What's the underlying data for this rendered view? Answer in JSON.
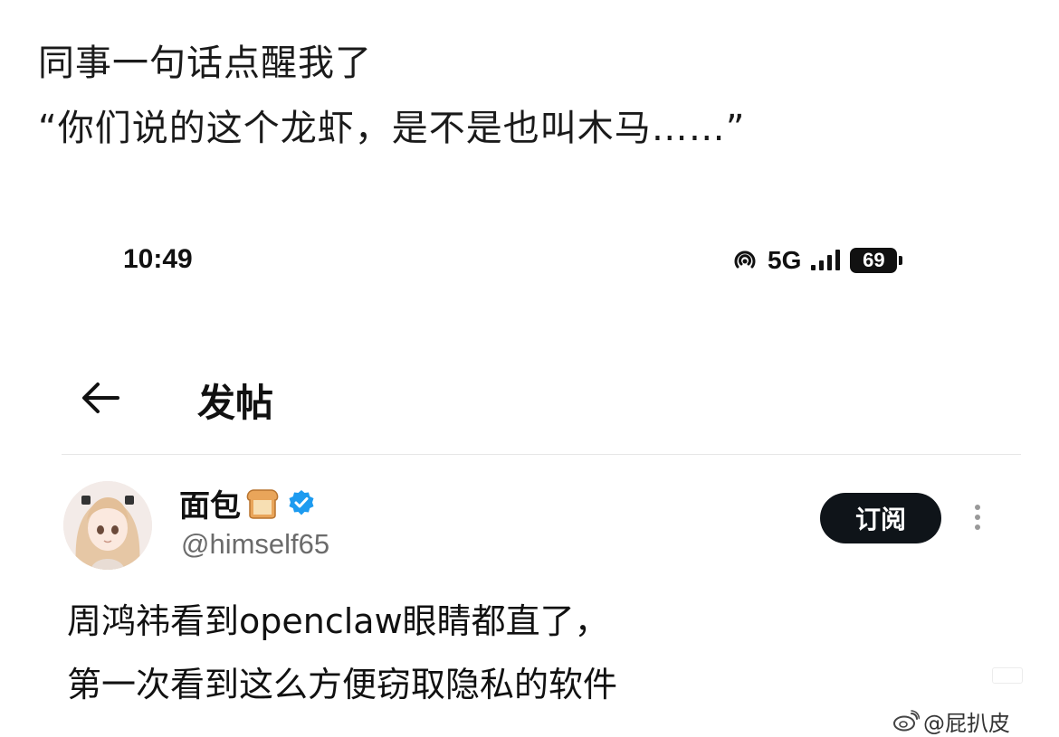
{
  "caption": {
    "line1": "同事一句话点醒我了",
    "line2": "“你们说的这个龙虾，是不是也叫木马……”"
  },
  "status_bar": {
    "time": "10:49",
    "network": "5G",
    "battery": "69",
    "icons": [
      "hotspot-icon",
      "signal-icon",
      "battery-icon"
    ]
  },
  "header": {
    "title": "发帖",
    "back_icon": "back-arrow-icon"
  },
  "post": {
    "user_name": "面包",
    "name_emoji": "bread-icon",
    "verified_icon": "verified-badge-icon",
    "handle": "@himself65",
    "subscribe_label": "订阅",
    "more_icon": "more-vertical-icon",
    "text_line1": "周鸿祎看到openclaw眼睛都直了，",
    "text_line2": "第一次看到这么方便窃取隐私的软件"
  },
  "watermark": {
    "text": "@屁扒皮",
    "icon": "weibo-icon"
  },
  "colors": {
    "subscribe_bg": "#0f1419",
    "verified_blue": "#1d9bf0",
    "handle_gray": "#6b6b6b"
  }
}
